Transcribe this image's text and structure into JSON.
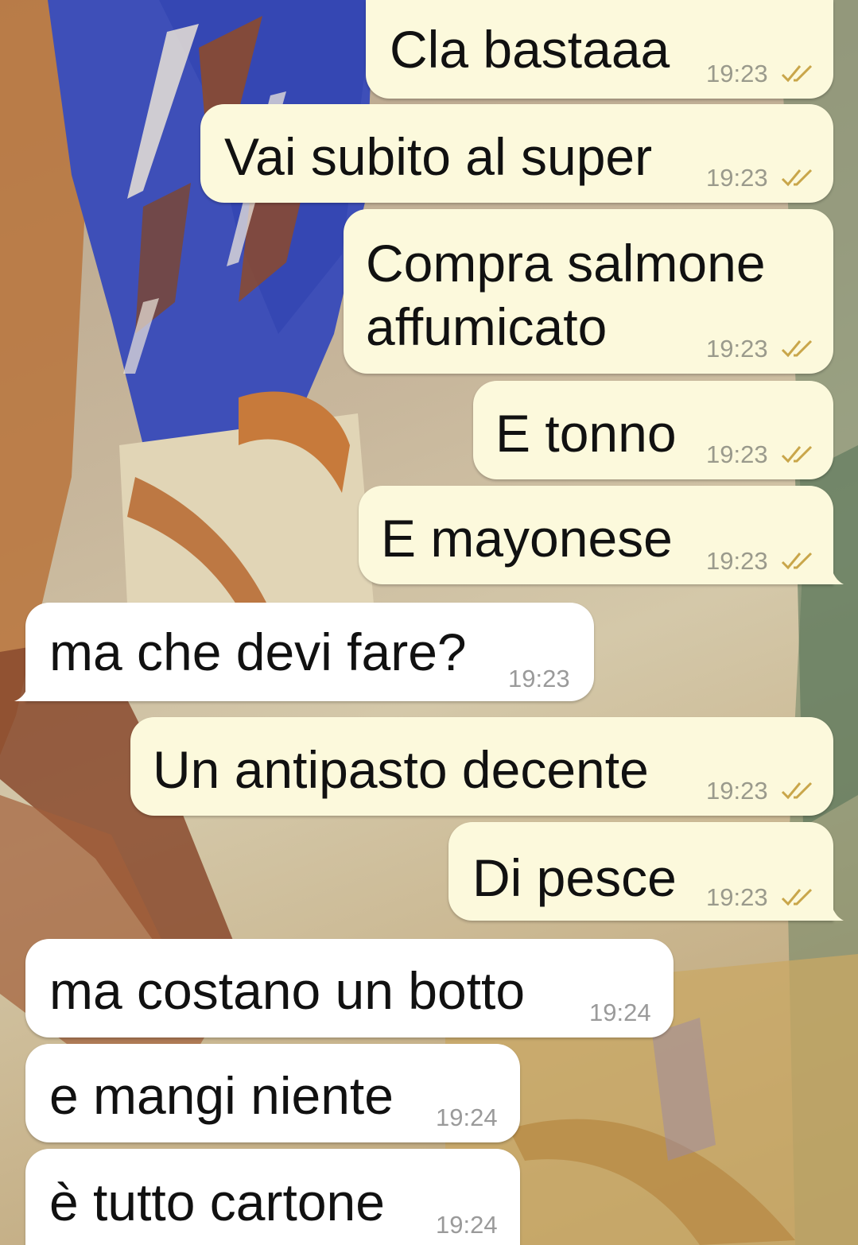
{
  "colors": {
    "outgoing_bubble": "#fcf9dc",
    "incoming_bubble": "#ffffff",
    "read_ticks": "#c9a64a",
    "timestamp": "#9a9a8c"
  },
  "icons": {
    "read_receipt": "double-check-icon"
  },
  "messages": [
    {
      "direction": "outgoing",
      "text": "Cla bastaaa",
      "time": "19:23",
      "status": "read"
    },
    {
      "direction": "outgoing",
      "text": "Vai subito al super",
      "time": "19:23",
      "status": "read"
    },
    {
      "direction": "outgoing",
      "text": "Compra salmone\naffumicato",
      "time": "19:23",
      "status": "read"
    },
    {
      "direction": "outgoing",
      "text": "E tonno",
      "time": "19:23",
      "status": "read"
    },
    {
      "direction": "outgoing",
      "text": "E mayonese",
      "time": "19:23",
      "status": "read"
    },
    {
      "direction": "incoming",
      "text": "ma che devi fare?",
      "time": "19:23"
    },
    {
      "direction": "outgoing",
      "text": "Un antipasto decente",
      "time": "19:23",
      "status": "read"
    },
    {
      "direction": "outgoing",
      "text": "Di pesce",
      "time": "19:23",
      "status": "read"
    },
    {
      "direction": "incoming",
      "text": "ma costano un botto",
      "time": "19:24"
    },
    {
      "direction": "incoming",
      "text": "e mangi niente",
      "time": "19:24"
    },
    {
      "direction": "incoming",
      "text": "è tutto cartone",
      "time": "19:24"
    }
  ]
}
